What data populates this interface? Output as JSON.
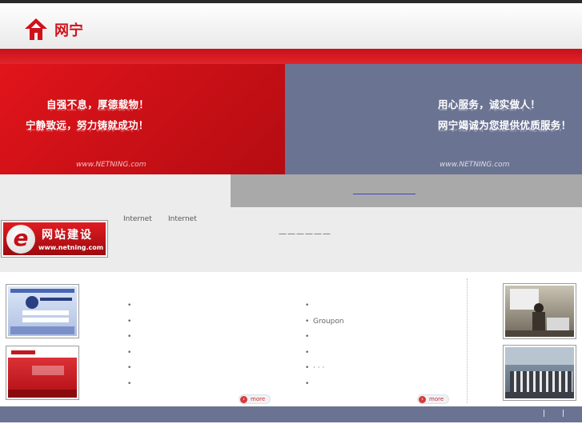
{
  "header": {
    "logo_text": "网宁"
  },
  "banner": {
    "left": {
      "line1": "自强不息，厚德载物！",
      "line2": "宁静致远，努力铸就成功！",
      "watermark": "www.NETNING.com"
    },
    "right": {
      "line1": "用心服务，诚实做人！",
      "line2": "网宁竭诚为您提供优质服务！",
      "watermark": "www.NETNING.com"
    }
  },
  "intro": {
    "badge_title": "网站建设",
    "badge_url": "www.netning.com",
    "badge_letter": "e",
    "text_a": "Internet",
    "text_b": "Internet",
    "dashes": "——————"
  },
  "content": {
    "list_left": [
      "",
      "",
      "",
      "",
      "",
      ""
    ],
    "list_right": [
      "",
      "Groupon",
      "",
      "",
      "·  ·  ·",
      ""
    ],
    "more_label": "more"
  },
  "footer": {
    "sep1": "|",
    "sep2": "|"
  },
  "colors": {
    "brand_red": "#d0111b",
    "slate": "#6b7392"
  }
}
